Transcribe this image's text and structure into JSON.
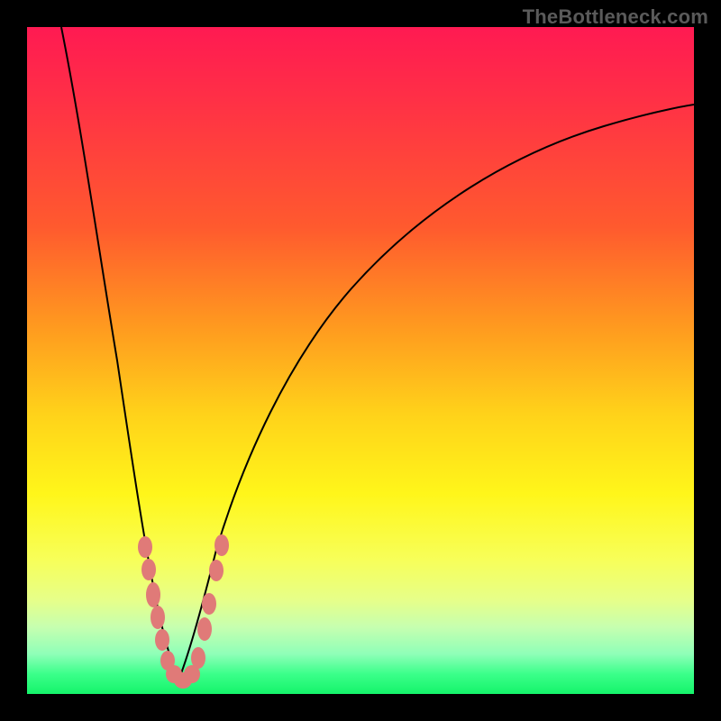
{
  "brand": {
    "label": "TheBottleneck.com"
  },
  "colors": {
    "top": "#ff1a52",
    "mid": "#fff61a",
    "bottom": "#15f46a",
    "bg": "#000000",
    "curve": "#000000",
    "marker": "#e07a78"
  },
  "chart_data": {
    "type": "line",
    "title": "",
    "xlabel": "",
    "ylabel": "",
    "xlim": [
      0,
      100
    ],
    "ylim": [
      0,
      100
    ],
    "grid": false,
    "legend": false,
    "series": [
      {
        "name": "left-branch",
        "x": [
          5,
          8,
          11,
          13,
          15,
          16.5,
          18,
          19.5,
          21,
          22
        ],
        "y": [
          100,
          82,
          62,
          48,
          36,
          28,
          20,
          14,
          8,
          2
        ]
      },
      {
        "name": "right-branch",
        "x": [
          22,
          24,
          27,
          31,
          36,
          42,
          50,
          60,
          72,
          85,
          100
        ],
        "y": [
          2,
          10,
          24,
          40,
          52,
          62,
          70,
          77,
          82,
          85,
          88
        ]
      }
    ],
    "markers": [
      {
        "x": 18.0,
        "y": 22
      },
      {
        "x": 18.4,
        "y": 19
      },
      {
        "x": 18.8,
        "y": 15
      },
      {
        "x": 19.5,
        "y": 12
      },
      {
        "x": 20.0,
        "y": 9
      },
      {
        "x": 20.5,
        "y": 6
      },
      {
        "x": 21.3,
        "y": 3.5
      },
      {
        "x": 22.0,
        "y": 2
      },
      {
        "x": 23.0,
        "y": 3
      },
      {
        "x": 23.8,
        "y": 5
      },
      {
        "x": 24.7,
        "y": 10
      },
      {
        "x": 25.3,
        "y": 14
      },
      {
        "x": 26.5,
        "y": 19
      },
      {
        "x": 27.3,
        "y": 23
      }
    ]
  }
}
